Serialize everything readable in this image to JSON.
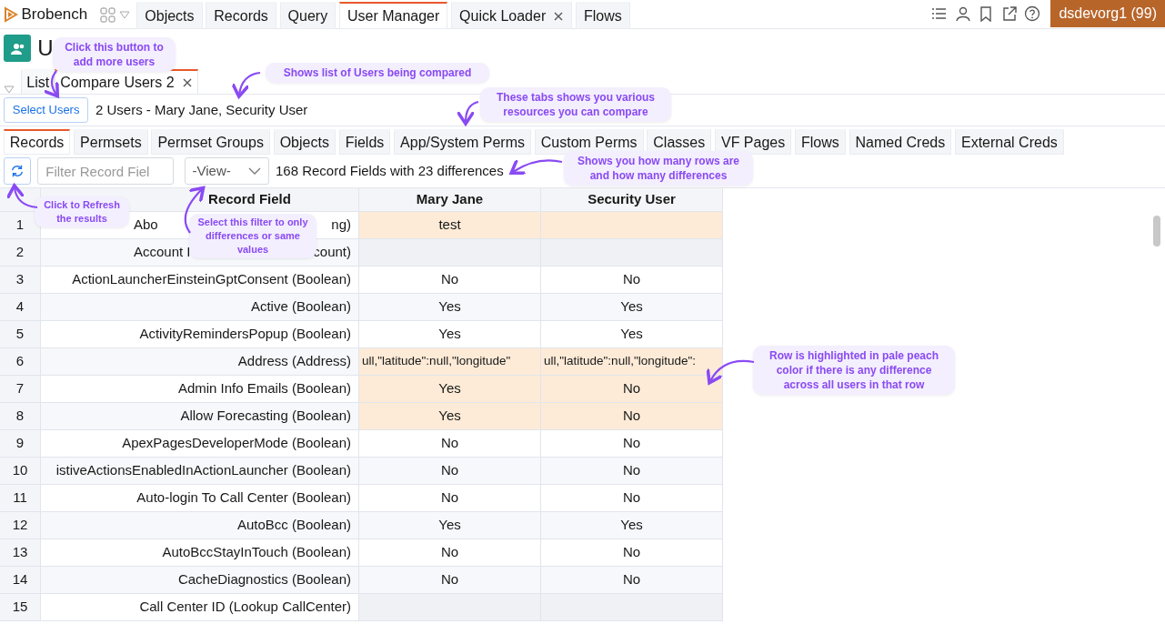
{
  "app": {
    "name": "Brobench",
    "org": "dsdevorg1 (99)"
  },
  "tabs": [
    {
      "label": "Objects",
      "selected": false,
      "closable": false
    },
    {
      "label": "Records",
      "selected": false,
      "closable": false
    },
    {
      "label": "Query",
      "selected": false,
      "closable": false
    },
    {
      "label": "User Manager",
      "selected": true,
      "closable": false
    },
    {
      "label": "Quick Loader",
      "selected": false,
      "closable": true
    },
    {
      "label": "Flows",
      "selected": false,
      "closable": false
    }
  ],
  "page_title": "U",
  "sub_tabs": [
    {
      "label": "List",
      "selected": false,
      "closable": false
    },
    {
      "label": "Compare Users 2",
      "selected": true,
      "closable": true
    }
  ],
  "select_button": "Select Users",
  "users_summary": "2 Users - Mary Jane, Security User",
  "resource_tabs": [
    {
      "label": "Records",
      "selected": true
    },
    {
      "label": "Permsets",
      "selected": false
    },
    {
      "label": "Permset Groups",
      "selected": false
    },
    {
      "label": "Objects",
      "selected": false
    },
    {
      "label": "Fields",
      "selected": false
    },
    {
      "label": "App/System Perms",
      "selected": false
    },
    {
      "label": "Custom Perms",
      "selected": false
    },
    {
      "label": "Classes",
      "selected": false
    },
    {
      "label": "VF Pages",
      "selected": false
    },
    {
      "label": "Flows",
      "selected": false
    },
    {
      "label": "Named Creds",
      "selected": false
    },
    {
      "label": "External Creds",
      "selected": false
    }
  ],
  "filter": {
    "placeholder": "Filter Record Fiel"
  },
  "view_select": "-View-",
  "count_text": "168 Record Fields with 23 differences",
  "table": {
    "columns": [
      "Record Field",
      "Mary Jane",
      "Security User"
    ],
    "rows": [
      {
        "num": "1",
        "field": "Abo",
        "field_end": "ng)",
        "cells": [
          {
            "text": "test"
          },
          {
            "blank": true
          }
        ],
        "diff": true
      },
      {
        "num": "2",
        "field": "Account I",
        "field_end": "count)",
        "cells": [
          {
            "blank": true
          },
          {
            "blank": true
          }
        ],
        "diff": false
      },
      {
        "num": "3",
        "field": "ActionLauncherEinsteinGptConsent (Boolean)",
        "values": [
          "No",
          "No"
        ],
        "diff": false
      },
      {
        "num": "4",
        "field": "Active (Boolean)",
        "values": [
          "Yes",
          "Yes"
        ],
        "diff": false
      },
      {
        "num": "5",
        "field": "ActivityRemindersPopup (Boolean)",
        "values": [
          "Yes",
          "Yes"
        ],
        "diff": false
      },
      {
        "num": "6",
        "field": "Address (Address)",
        "values": [
          "ull,\"latitude\":null,\"longitude\"",
          "ull,\"latitude\":null,\"longitude\":"
        ],
        "diff": true
      },
      {
        "num": "7",
        "field": "Admin Info Emails (Boolean)",
        "values": [
          "Yes",
          "No"
        ],
        "diff": true
      },
      {
        "num": "8",
        "field": "Allow Forecasting (Boolean)",
        "values": [
          "Yes",
          "No"
        ],
        "diff": true
      },
      {
        "num": "9",
        "field": "ApexPagesDeveloperMode (Boolean)",
        "values": [
          "No",
          "No"
        ],
        "diff": false
      },
      {
        "num": "10",
        "field": "istiveActionsEnabledInActionLauncher (Boolean)",
        "values": [
          "No",
          "No"
        ],
        "diff": false
      },
      {
        "num": "11",
        "field": "Auto-login To Call Center (Boolean)",
        "values": [
          "No",
          "No"
        ],
        "diff": false
      },
      {
        "num": "12",
        "field": "AutoBcc (Boolean)",
        "values": [
          "Yes",
          "Yes"
        ],
        "diff": false
      },
      {
        "num": "13",
        "field": "AutoBccStayInTouch (Boolean)",
        "values": [
          "No",
          "No"
        ],
        "diff": false
      },
      {
        "num": "14",
        "field": "CacheDiagnostics (Boolean)",
        "values": [
          "No",
          "No"
        ],
        "diff": false
      },
      {
        "num": "15",
        "field": "Call Center ID (Lookup CallCenter)",
        "cells": [
          {
            "blank": true
          },
          {
            "blank": true
          }
        ],
        "diff": false
      }
    ]
  },
  "annotations": [
    {
      "text": "Click this button to add more users"
    },
    {
      "text": "Shows list of Users being compared"
    },
    {
      "text": "These tabs shows you various resources you can compare"
    },
    {
      "text": "Shows you how many rows are and how many differences"
    },
    {
      "text": "Click to Refresh the results"
    },
    {
      "text": "Select this filter to only differences or same values"
    },
    {
      "text": "Row is highlighted in pale peach color if there is any difference across all users in that row"
    }
  ]
}
